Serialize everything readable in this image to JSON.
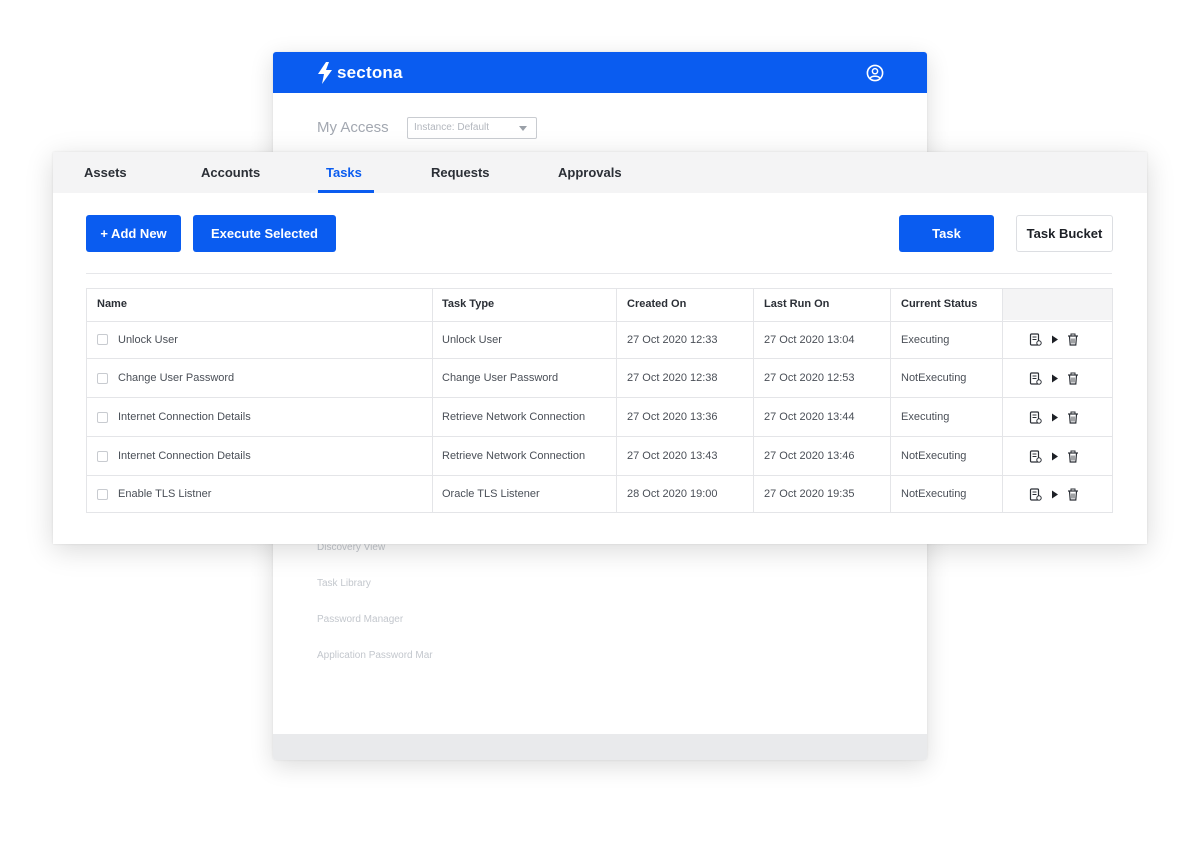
{
  "app": {
    "brand": "sectona",
    "colors": {
      "primary": "#0a5cf0",
      "tab_bg": "#f4f4f5",
      "footer_bg": "#e9eaec"
    }
  },
  "back_window": {
    "title": "My Access",
    "instance_select": {
      "value": "Instance: Default"
    },
    "menu": [
      {
        "label": "Discovery View"
      },
      {
        "label": "Task Library"
      },
      {
        "label": "Password Manager"
      },
      {
        "label": "Application Password Mar"
      }
    ],
    "icons": {
      "logo": "lightning-bolt-icon",
      "user": "user-circle-icon"
    }
  },
  "tabs": [
    {
      "label": "Assets"
    },
    {
      "label": "Accounts"
    },
    {
      "label": "Tasks",
      "active": true
    },
    {
      "label": "Requests"
    },
    {
      "label": "Approvals"
    }
  ],
  "toolbar": {
    "add_new": "+ Add New",
    "execute_selected": "Execute Selected",
    "task": "Task",
    "task_bucket": "Task Bucket"
  },
  "table": {
    "columns": [
      "Name",
      "Task Type",
      "Created On",
      "Last Run On",
      "Current Status"
    ],
    "rows": [
      {
        "name": "Unlock User",
        "task_type": "Unlock User",
        "created_on": "27 Oct 2020 12:33",
        "last_run_on": "27 Oct 2020 13:04",
        "status": "Executing"
      },
      {
        "name": "Change User Password",
        "task_type": "Change User Password",
        "created_on": "27 Oct 2020 12:38",
        "last_run_on": "27 Oct 2020 12:53",
        "status": "NotExecuting"
      },
      {
        "name": "Internet Connection Details",
        "task_type": "Retrieve Network Connection",
        "created_on": "27 Oct 2020 13:36",
        "last_run_on": "27 Oct 2020 13:44",
        "status": "Executing"
      },
      {
        "name": "Internet Connection Details",
        "task_type": "Retrieve Network Connection",
        "created_on": "27 Oct 2020 13:43",
        "last_run_on": "27 Oct 2020 13:46",
        "status": "NotExecuting"
      },
      {
        "name": "Enable TLS Listner",
        "task_type": "Oracle TLS Listener",
        "created_on": "28 Oct 2020 19:00",
        "last_run_on": "27 Oct 2020 19:35",
        "status": "NotExecuting"
      }
    ],
    "row_action_icons": [
      "edit-document-icon",
      "play-icon",
      "trash-icon"
    ]
  }
}
